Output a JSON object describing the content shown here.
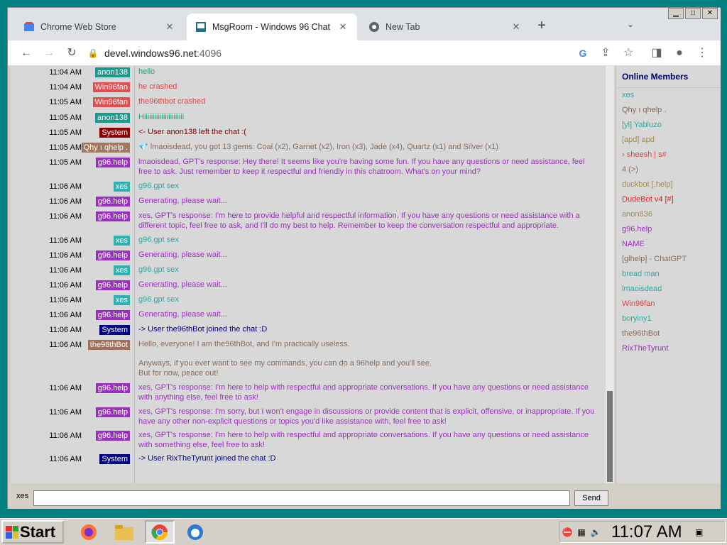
{
  "browser": {
    "tabs": [
      {
        "title": "Chrome Web Store",
        "icon": "chrome-web-store-icon",
        "active": false
      },
      {
        "title": "MsgRoom - Windows 96 Chat",
        "icon": "msgroom-icon",
        "active": true
      },
      {
        "title": "New Tab",
        "icon": "chrome-icon",
        "active": false
      }
    ],
    "url_host": "devel.windows96.net",
    "url_port": ":4096"
  },
  "chat": {
    "messages": [
      {
        "time": "11:04 AM",
        "user": "anon138",
        "user_bg": "#1a9a8a",
        "text": "hello",
        "text_color": "#2a9a7a"
      },
      {
        "time": "11:04 AM",
        "user": "Win96fan",
        "user_bg": "#e05050",
        "text": "he crashed",
        "text_color": "#e04040"
      },
      {
        "time": "11:05 AM",
        "user": "Win96fan",
        "user_bg": "#e05050",
        "text": "the96thbot crashed",
        "text_color": "#e04040"
      },
      {
        "time": "11:05 AM",
        "user": "anon138",
        "user_bg": "#1a9a8a",
        "text": "Hiiiiiiiiiiiiiiiiiiiiiii",
        "text_color": "#2a9a7a"
      },
      {
        "time": "11:05 AM",
        "user": "System",
        "user_bg": "#8b0000",
        "text": "<- User anon138 left the chat :(",
        "text_color": "#800000"
      },
      {
        "time": "11:05 AM",
        "user": "Qhy ı qhelp .",
        "user_bg": "#a07860",
        "text": "💎 lmaoisdead, you got 13 gems: Coal (x2), Garnet (x2), Iron (x3), Jade (x4), Quartz (x1) and Silver (x1)",
        "text_color": "#8a6a5a"
      },
      {
        "time": "11:05 AM",
        "user": "g96.help",
        "user_bg": "#9b30c0",
        "text": "lmaoisdead, GPT's response: Hey there! It seems like you're having some fun. If you have any questions or need assistance, feel free to ask. Just remember to keep it respectful and friendly in this chatroom. What's on your mind?",
        "text_color": "#9b30c0"
      },
      {
        "time": "11:06 AM",
        "user": "xes",
        "user_bg": "#30b0b0",
        "text": "g96.gpt sex",
        "text_color": "#30a8a0"
      },
      {
        "time": "11:06 AM",
        "user": "g96.help",
        "user_bg": "#9b30c0",
        "text": "Generating, please wait...",
        "text_color": "#9b30c0"
      },
      {
        "time": "11:06 AM",
        "user": "g96.help",
        "user_bg": "#9b30c0",
        "text": "xes, GPT's response: I'm here to provide helpful and respectful information. If you have any questions or need assistance with a different topic, feel free to ask, and I'll do my best to help. Remember to keep the conversation respectful and appropriate.",
        "text_color": "#9b30c0"
      },
      {
        "time": "11:06 AM",
        "user": "xes",
        "user_bg": "#30b0b0",
        "text": "g96.gpt sex",
        "text_color": "#30a8a0"
      },
      {
        "time": "11:06 AM",
        "user": "g96.help",
        "user_bg": "#9b30c0",
        "text": "Generating, please wait...",
        "text_color": "#9b30c0"
      },
      {
        "time": "11:06 AM",
        "user": "xes",
        "user_bg": "#30b0b0",
        "text": "g96.gpt sex",
        "text_color": "#30a8a0"
      },
      {
        "time": "11:06 AM",
        "user": "g96.help",
        "user_bg": "#9b30c0",
        "text": "Generating, please wait...",
        "text_color": "#9b30c0"
      },
      {
        "time": "11:06 AM",
        "user": "xes",
        "user_bg": "#30b0b0",
        "text": "g96.gpt sex",
        "text_color": "#30a8a0"
      },
      {
        "time": "11:06 AM",
        "user": "g96.help",
        "user_bg": "#9b30c0",
        "text": "Generating, please wait...",
        "text_color": "#9b30c0"
      },
      {
        "time": "11:06 AM",
        "user": "System",
        "user_bg": "#000080",
        "text": "-> User the96thBot joined the chat :D",
        "text_color": "#000080"
      },
      {
        "time": "11:06 AM",
        "user": "the96thBot",
        "user_bg": "#a0705a",
        "text": "Hello, everyone! I am the96thBot, and I'm practically useless.\n\nAnyways, if you ever want to see my commands, you can do a 96help and you'll see.\nBut for now, peace out!",
        "text_color": "#8a6a5a"
      },
      {
        "time": "11:06 AM",
        "user": "g96.help",
        "user_bg": "#9b30c0",
        "text": "xes, GPT's response: I'm here to help with respectful and appropriate conversations. If you have any questions or need assistance with anything else, feel free to ask!",
        "text_color": "#9b30c0"
      },
      {
        "time": "11:06 AM",
        "user": "g96.help",
        "user_bg": "#9b30c0",
        "text": "xes, GPT's response: I'm sorry, but I won't engage in discussions or provide content that is explicit, offensive, or inappropriate. If you have any other non-explicit questions or topics you'd like assistance with, feel free to ask!",
        "text_color": "#9b30c0"
      },
      {
        "time": "11:06 AM",
        "user": "g96.help",
        "user_bg": "#9b30c0",
        "text": "xes, GPT's response: I'm here to help with respectful and appropriate conversations. If you have any questions or need assistance with something else, feel free to ask!",
        "text_color": "#9b30c0"
      },
      {
        "time": "11:06 AM",
        "user": "System",
        "user_bg": "#000080",
        "text": "-> User RixTheTyrunt joined the chat :D",
        "text_color": "#000080"
      }
    ],
    "members_title": "Online Members",
    "members": [
      {
        "name": "xes",
        "color": "#30a8a0"
      },
      {
        "name": "Qhy ı qhelp .",
        "color": "#8a6a5a"
      },
      {
        "name": "[yl] Yabluzo",
        "color": "#30a8a0"
      },
      {
        "name": "[apd] apd",
        "color": "#a08a50"
      },
      {
        "name": "› sheesh | s#",
        "color": "#e04040"
      },
      {
        "name": "4 (>)",
        "color": "#8a6a5a"
      },
      {
        "name": "duckbot [.help]",
        "color": "#a08a50"
      },
      {
        "name": "DudeBot v4 [#]",
        "color": "#e02020"
      },
      {
        "name": "anon836",
        "color": "#a08a50"
      },
      {
        "name": "g96.help",
        "color": "#9b30c0"
      },
      {
        "name": "NAME",
        "color": "#9b30c0"
      },
      {
        "name": "[glhelp] - ChatGPT",
        "color": "#8a6a5a"
      },
      {
        "name": "bread man",
        "color": "#30a8a0"
      },
      {
        "name": "lmaoisdead",
        "color": "#30a8a0"
      },
      {
        "name": "Win96fan",
        "color": "#e04040"
      },
      {
        "name": "boryiny1",
        "color": "#30a8a0"
      },
      {
        "name": "the96thBot",
        "color": "#8a6a5a"
      },
      {
        "name": "RixTheTyrunt",
        "color": "#9b30c0"
      }
    ],
    "nick": "xes",
    "input_value": "",
    "send_label": "Send"
  },
  "taskbar": {
    "start_label": "Start",
    "clock": "11:07 AM"
  }
}
